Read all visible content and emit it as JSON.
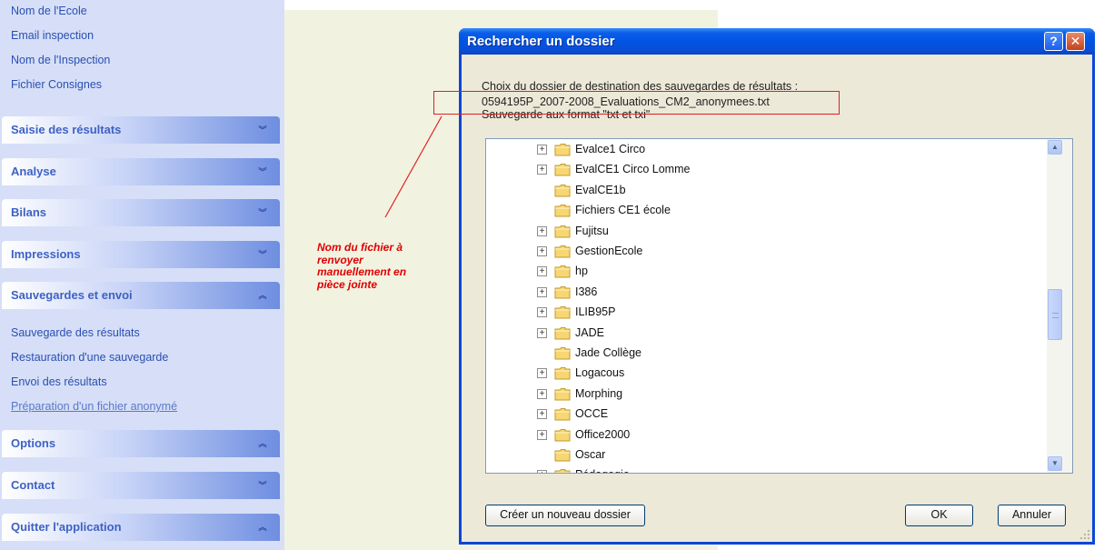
{
  "sidebar": {
    "top_links": [
      "Nom de l'Ecole",
      "Email inspection",
      "Nom de l'Inspection",
      "Fichier Consignes"
    ],
    "sections": [
      {
        "label": "Saisie des résultats",
        "expanded": false
      },
      {
        "label": "Analyse",
        "expanded": false
      },
      {
        "label": "Bilans",
        "expanded": false
      },
      {
        "label": "Impressions",
        "expanded": false
      },
      {
        "label": "Sauvegardes et envoi",
        "expanded": true
      },
      {
        "label": "Options",
        "expanded": true
      },
      {
        "label": "Contact",
        "expanded": false
      },
      {
        "label": "Quitter l'application",
        "expanded": true
      }
    ],
    "sub_links": [
      "Sauvegarde des résultats",
      "Restauration d'une sauvegarde",
      "Envoi des résultats",
      "Préparation d'un fichier anonymé"
    ]
  },
  "annotation": {
    "text": "Nom du fichier à renvoyer manuellement en pièce jointe",
    "color": "#e00000"
  },
  "dialog": {
    "title": "Rechercher un dossier",
    "help_label": "?",
    "close_label": "✕",
    "prompt_line1": "Choix du dossier de destination des sauvegardes de résultats :",
    "prompt_line2": "0594195P_2007-2008_Evaluations_CM2_anonymees.txt",
    "prompt_line3": "Sauvegarde aux format \"txt et txi\"",
    "tree": [
      {
        "label": "Evalce1 Circo",
        "expandable": true
      },
      {
        "label": "EvalCE1 Circo Lomme",
        "expandable": true
      },
      {
        "label": "EvalCE1b",
        "expandable": false
      },
      {
        "label": "Fichiers CE1 école",
        "expandable": false
      },
      {
        "label": "Fujitsu",
        "expandable": true
      },
      {
        "label": "GestionEcole",
        "expandable": true
      },
      {
        "label": "hp",
        "expandable": true
      },
      {
        "label": "I386",
        "expandable": true
      },
      {
        "label": "ILIB95P",
        "expandable": true
      },
      {
        "label": "JADE",
        "expandable": true
      },
      {
        "label": "Jade Collège",
        "expandable": false
      },
      {
        "label": "Logacous",
        "expandable": true
      },
      {
        "label": "Morphing",
        "expandable": true
      },
      {
        "label": "OCCE",
        "expandable": true
      },
      {
        "label": "Office2000",
        "expandable": true
      },
      {
        "label": "Oscar",
        "expandable": false
      },
      {
        "label": "Pédagogie",
        "expandable": true
      }
    ],
    "new_folder_label": "Créer un nouveau dossier",
    "ok_label": "OK",
    "cancel_label": "Annuler"
  },
  "colors": {
    "sidebar_bg": "#d6dff7",
    "link": "#2b4fb3",
    "header_text": "#3e62c4",
    "titlebar": "#0054e3",
    "dialog_bg": "#ece9d8",
    "main_bg": "#f2f2e1",
    "folder": "#f6d774"
  },
  "icons": {
    "folder": "folder-icon",
    "expand": "plus-box-icon",
    "collapse_chevron": "double-chevron-down-icon",
    "expand_chevron": "double-chevron-up-icon"
  }
}
